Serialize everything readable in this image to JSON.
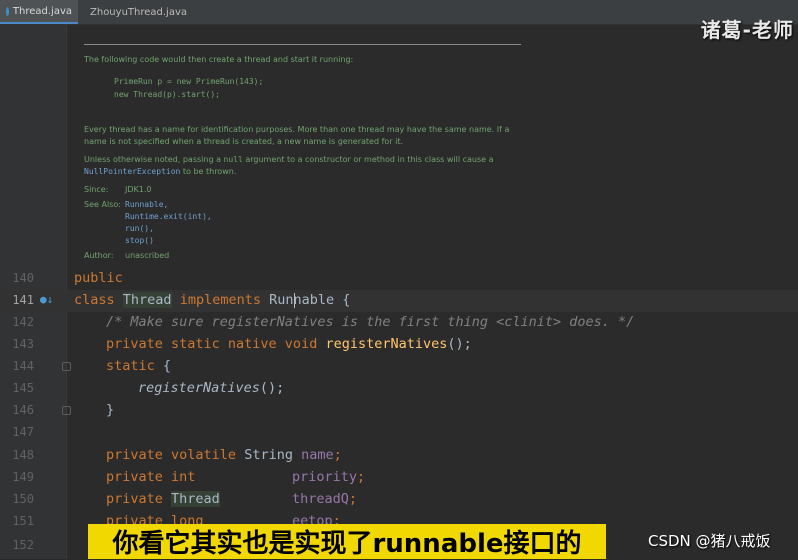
{
  "tabs": [
    {
      "label": "Thread.java",
      "active": true
    },
    {
      "label": "ZhouyuThread.java",
      "active": false
    }
  ],
  "watermark": "诸葛-老师",
  "doc": {
    "intro": "The following code would then create a thread and start it running:",
    "code_lines": [
      "PrimeRun p = new PrimeRun(143);",
      "new Thread(p).start();"
    ],
    "para1": "Every thread has a name for identification purposes. More than one thread may have the same name. If a name is not specified when a thread is created, a new name is generated for it.",
    "para2_pre": "Unless otherwise noted, passing a ",
    "para2_null": "null",
    "para2_mid": " argument to a constructor or method in this class will cause a ",
    "para2_npe": "NullPointerException",
    "para2_post": " to be thrown.",
    "since_label": "Since:",
    "since_value": "JDK1.0",
    "see_also_label": "See Also:",
    "see_also": [
      "Runnable,",
      "Runtime.exit(int),",
      "run(),",
      "stop()"
    ],
    "author_label": "Author:",
    "author_value": "unascribed"
  },
  "lines": [
    {
      "num": "140"
    },
    {
      "num": "141"
    },
    {
      "num": "142"
    },
    {
      "num": "143"
    },
    {
      "num": "144"
    },
    {
      "num": "145"
    },
    {
      "num": "146"
    },
    {
      "num": "147"
    },
    {
      "num": "148"
    },
    {
      "num": "149"
    },
    {
      "num": "150"
    },
    {
      "num": "151"
    },
    {
      "num": "152"
    }
  ],
  "code": {
    "l140": "public",
    "l141_class": "class",
    "l141_name": "Thread",
    "l141_impl": "implements",
    "l141_iface_a": "Run",
    "l141_iface_b": "nable {",
    "l142": "/* Make sure registerNatives is the first thing <clinit> does. */",
    "l143_mods": "private static native void",
    "l143_fn": "registerNatives",
    "l143_end": "();",
    "l144_kw": "static",
    "l144_end": " {",
    "l145_fn": "registerNatives",
    "l145_end": "();",
    "l146": "}",
    "l148_mods": "private volatile",
    "l148_type": "String",
    "l148_field": "name",
    "l149_mods": "private int",
    "l149_field": "priority",
    "l150_mods": "private",
    "l150_type": "Thread",
    "l150_field": "threadQ",
    "l151_mods": "private long",
    "l151_field": "eetop"
  },
  "subtitle": "你看它其实也是实现了runnable接口的",
  "credit": "CSDN @猪八戒饭"
}
